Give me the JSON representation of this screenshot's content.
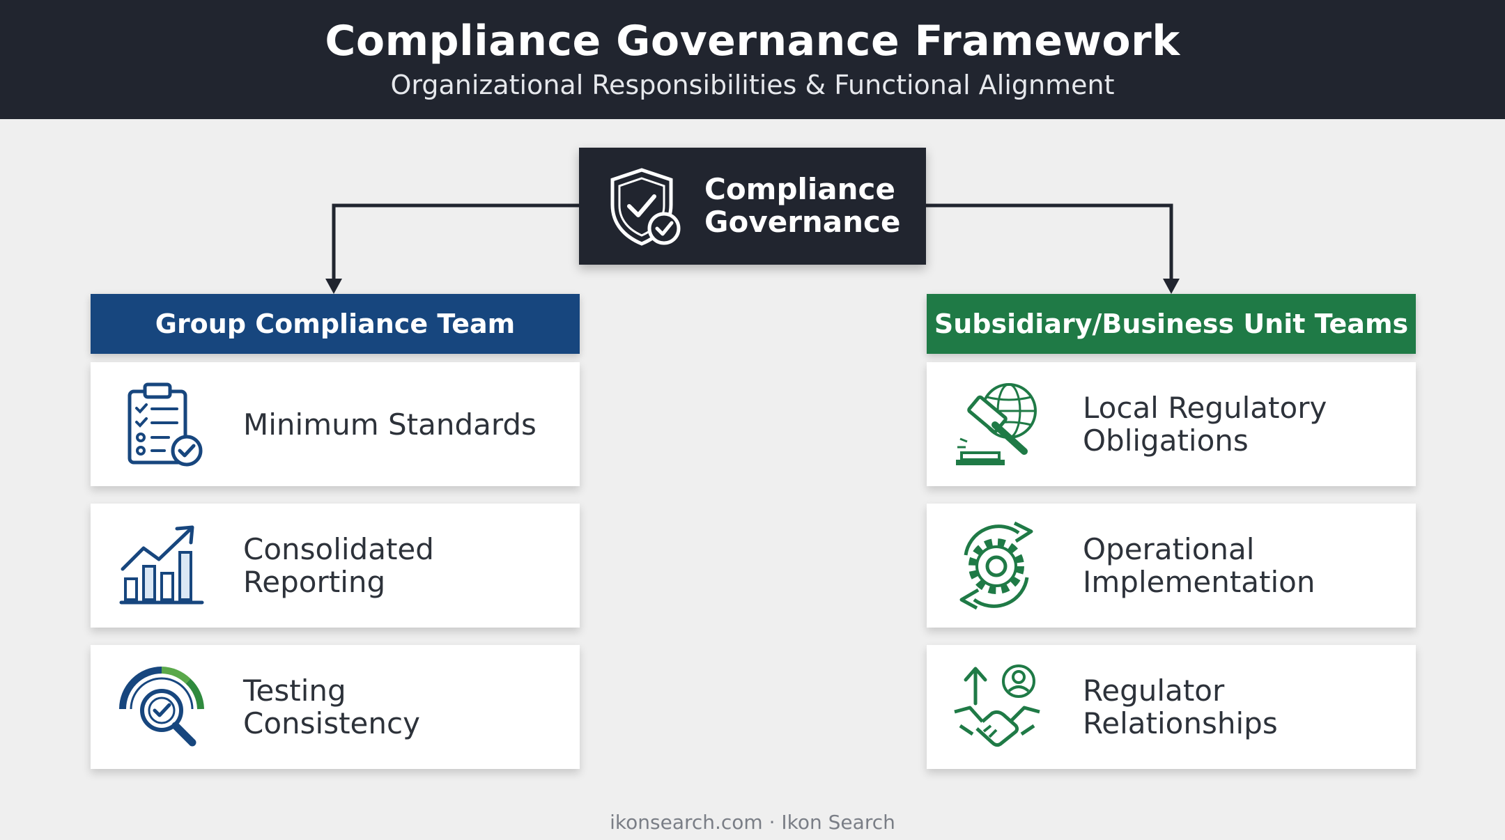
{
  "header": {
    "title": "Compliance Governance Framework",
    "subtitle": "Organizational Responsibilities & Functional Alignment"
  },
  "root": {
    "label_line1": "Compliance",
    "label_line2": "Governance",
    "icon": "shield-check-icon"
  },
  "left_column": {
    "title": "Group Compliance Team",
    "color": "#17467e",
    "items": [
      {
        "line1": "Minimum Standards",
        "line2": "",
        "icon": "clipboard-checklist-icon"
      },
      {
        "line1": "Consolidated",
        "line2": "Reporting",
        "icon": "bar-chart-trend-icon"
      },
      {
        "line1": "Testing",
        "line2": "Consistency",
        "icon": "gauge-magnifier-icon"
      }
    ]
  },
  "right_column": {
    "title": "Subsidiary/Business Unit Teams",
    "color": "#1f7a46",
    "items": [
      {
        "line1": "Local Regulatory",
        "line2": "Obligations",
        "icon": "globe-gavel-icon"
      },
      {
        "line1": "Operational",
        "line2": "Implementation",
        "icon": "gear-cycle-icon"
      },
      {
        "line1": "Regulator",
        "line2": "Relationships",
        "icon": "handshake-person-icon"
      }
    ]
  },
  "footer": {
    "text": "ikonsearch.com · Ikon Search"
  }
}
